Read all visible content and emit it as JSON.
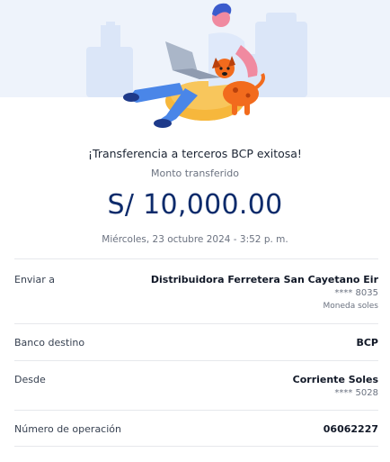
{
  "receipt": {
    "title": "¡Transferencia a terceros BCP exitosa!",
    "amount_label": "Monto transferido",
    "amount": "S/ 10,000.00",
    "datetime": "Miércoles, 23 octubre 2024 - 3:52 p. m."
  },
  "details": {
    "send_to": {
      "label": "Enviar a",
      "name": "Distribuidora Ferretera San Cayetano Eir",
      "account": "**** 8035",
      "currency": "Moneda soles"
    },
    "bank": {
      "label": "Banco destino",
      "value": "BCP"
    },
    "from": {
      "label": "Desde",
      "account_type": "Corriente Soles",
      "account": "**** 5028"
    },
    "operation": {
      "label": "Número de operación",
      "value": "06062227"
    }
  },
  "colors": {
    "hero_background": "#eef3fb",
    "amount": "#0d2b6b",
    "accent_orange": "#f26b1d",
    "accent_blue": "#5b8fe8"
  },
  "icons": [
    "person-with-laptop-illustration",
    "dog-illustration"
  ]
}
